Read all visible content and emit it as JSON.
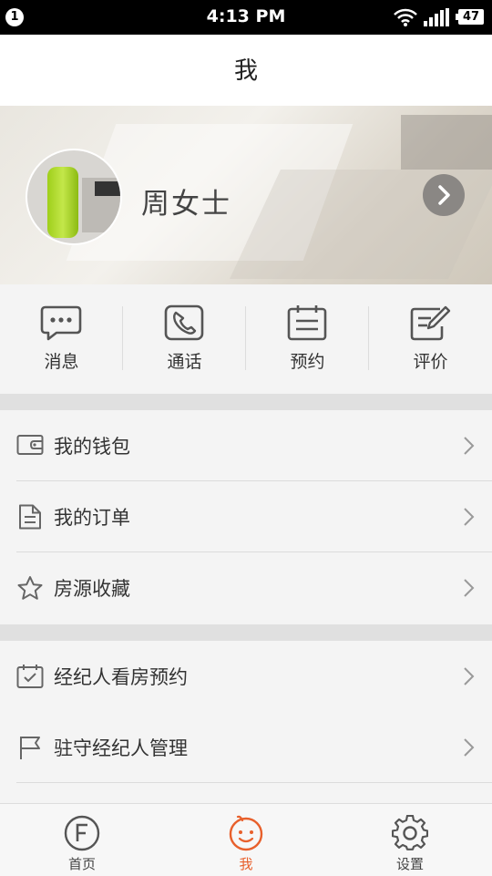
{
  "status_bar": {
    "notification_count": "1",
    "time": "4:13 PM",
    "battery": "47"
  },
  "header": {
    "title": "我"
  },
  "profile": {
    "name": "周女士"
  },
  "quick_actions": [
    {
      "label": "消息",
      "icon": "message-icon"
    },
    {
      "label": "通话",
      "icon": "phone-icon"
    },
    {
      "label": "预约",
      "icon": "calendar-icon"
    },
    {
      "label": "评价",
      "icon": "edit-icon"
    }
  ],
  "menu_group_1": [
    {
      "label": "我的钱包",
      "icon": "wallet-icon"
    },
    {
      "label": "我的订单",
      "icon": "document-icon"
    },
    {
      "label": "房源收藏",
      "icon": "star-icon"
    }
  ],
  "menu_group_2": [
    {
      "label": "经纪人看房预约",
      "icon": "calendar-check-icon"
    },
    {
      "label": "驻守经纪人管理",
      "icon": "flag-icon"
    }
  ],
  "tabs": [
    {
      "label": "首页",
      "icon": "home-f-icon"
    },
    {
      "label": "我",
      "icon": "smiley-icon",
      "active": true
    },
    {
      "label": "设置",
      "icon": "gear-icon"
    }
  ],
  "colors": {
    "accent": "#e8602c",
    "icon_gray": "#555555"
  }
}
